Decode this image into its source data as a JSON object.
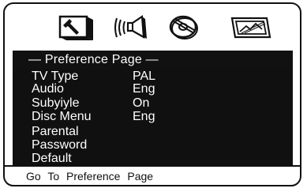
{
  "tabs": [
    {
      "name": "general-setup",
      "icon": "wrench-icon"
    },
    {
      "name": "audio-setup",
      "icon": "speaker-icon"
    },
    {
      "name": "video-setup",
      "icon": "disc-icon"
    },
    {
      "name": "preference-page",
      "icon": "picture-icon",
      "selected": true
    }
  ],
  "header": {
    "title": "— Preference Page —"
  },
  "menu": {
    "items": [
      {
        "label": "TV Type",
        "value": "PAL"
      },
      {
        "label": "Audio",
        "value": "Eng"
      },
      {
        "label": "Subyiyle",
        "value": "On"
      },
      {
        "label": "Disc Menu",
        "value": "Eng"
      },
      {
        "label": "Parental",
        "value": ""
      },
      {
        "label": "Password",
        "value": ""
      },
      {
        "label": "Default",
        "value": ""
      }
    ]
  },
  "footer": {
    "hint": "Go To Preference Page"
  },
  "colors": {
    "background": "#ffffff",
    "panel": "#101010",
    "text_on_panel": "#ffffff",
    "border": "#111111"
  }
}
